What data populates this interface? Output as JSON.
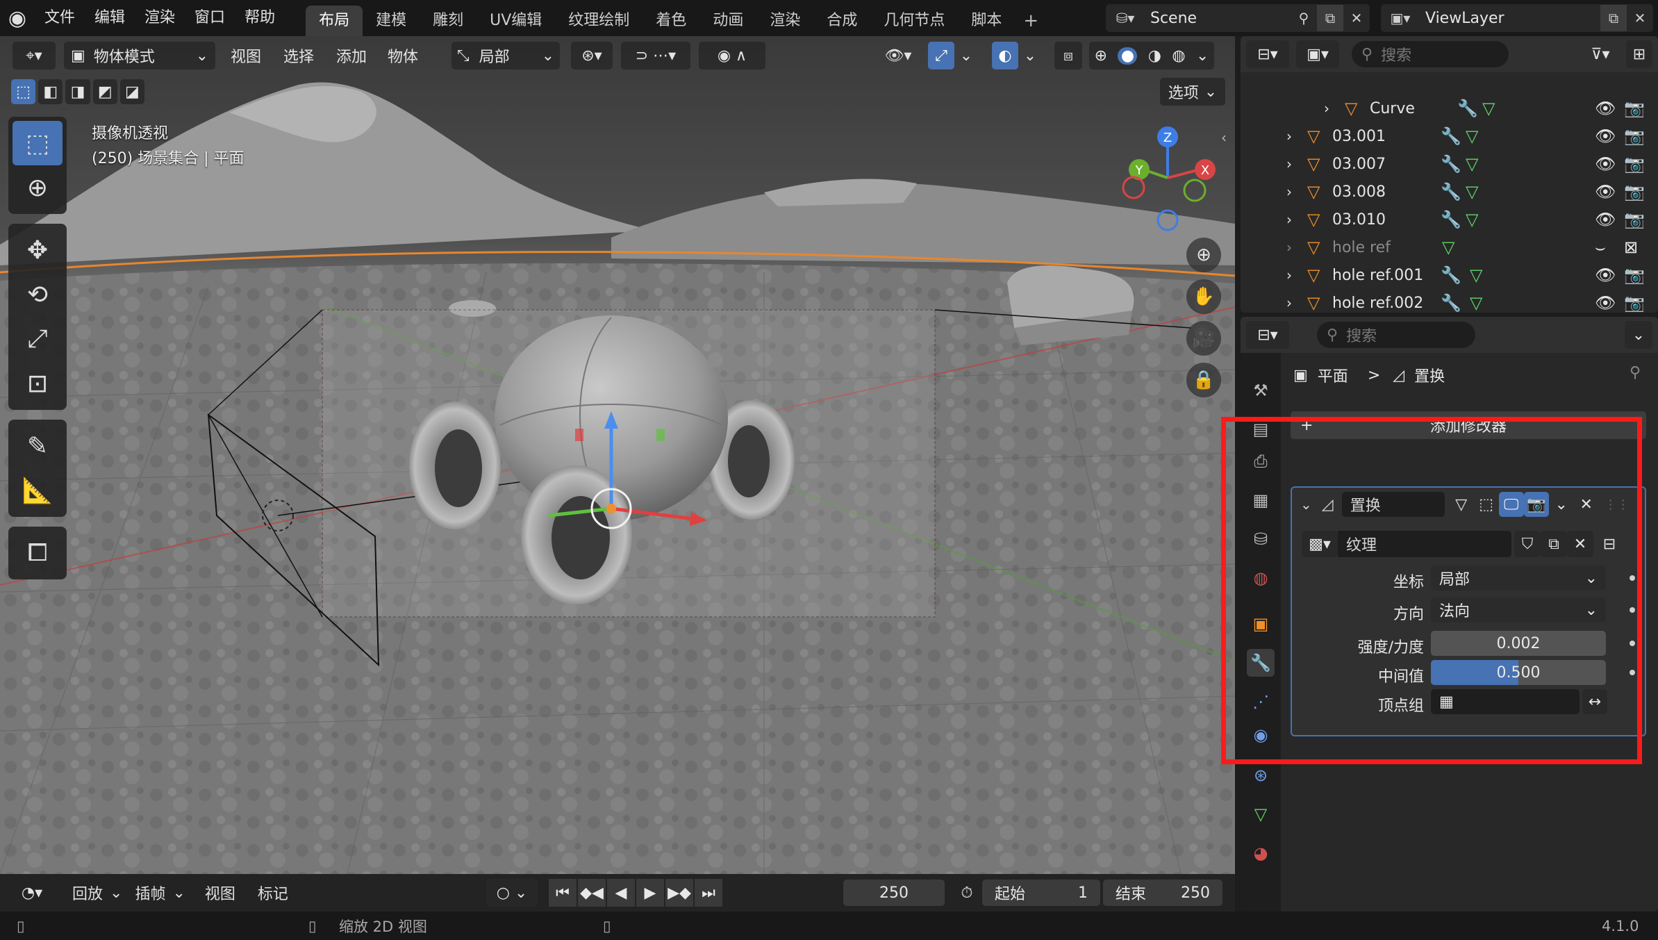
{
  "topbar": {
    "menus": [
      "文件",
      "编辑",
      "渲染",
      "窗口",
      "帮助"
    ],
    "workspaces": [
      "布局",
      "建模",
      "雕刻",
      "UV编辑",
      "纹理绘制",
      "着色",
      "动画",
      "渲染",
      "合成",
      "几何节点",
      "脚本"
    ],
    "active_workspace": "布局",
    "add_workspace": "+",
    "scene_name": "Scene",
    "view_layer": "ViewLayer"
  },
  "viewport": {
    "mode": "物体模式",
    "menus": [
      "视图",
      "选择",
      "添加",
      "物体"
    ],
    "transform_orientation": "局部",
    "options_label": "选项",
    "overlay_title": "摄像机透视",
    "overlay_subtitle": "(250) 场景集合 | 平面",
    "gizmo": {
      "z": "Z",
      "y": "Y",
      "x": "X"
    }
  },
  "timeline": {
    "menus": [
      "回放",
      "插帧",
      "视图",
      "标记"
    ],
    "current_frame": "250",
    "start_label": "起始",
    "start_value": "1",
    "end_label": "结束",
    "end_value": "250"
  },
  "statusbar": {
    "hint": "缩放 2D 视图",
    "version": "4.1.0"
  },
  "outliner": {
    "search_placeholder": "搜索",
    "rows": [
      {
        "name": "Curve",
        "dim": false
      },
      {
        "name": "03.001",
        "dim": false
      },
      {
        "name": "03.007",
        "dim": false
      },
      {
        "name": "03.008",
        "dim": false
      },
      {
        "name": "03.010",
        "dim": false
      },
      {
        "name": "hole ref",
        "dim": true
      },
      {
        "name": "hole ref.001",
        "dim": false
      },
      {
        "name": "hole ref.002",
        "dim": false
      }
    ]
  },
  "properties": {
    "search_placeholder": "搜索",
    "breadcrumb_object": "平面",
    "breadcrumb_sep": ">",
    "breadcrumb_modifier": "置换",
    "add_modifier": "添加修改器",
    "modifier_name": "置换",
    "texture_name": "纹理",
    "fields": [
      {
        "label": "坐标",
        "value": "局部"
      },
      {
        "label": "方向",
        "value": "法向"
      },
      {
        "label": "强度/力度",
        "value": "0.002"
      },
      {
        "label": "中间值",
        "value": "0.500"
      },
      {
        "label": "顶点组",
        "value": ""
      }
    ],
    "midlevel_fraction": 0.5
  },
  "colors": {
    "accent": "#4772b3",
    "highlight_box": "#ff1a1a",
    "object_orange": "#f0902a",
    "mesh_green": "#5fd86a",
    "modifier_blue": "#6f9fe8"
  }
}
